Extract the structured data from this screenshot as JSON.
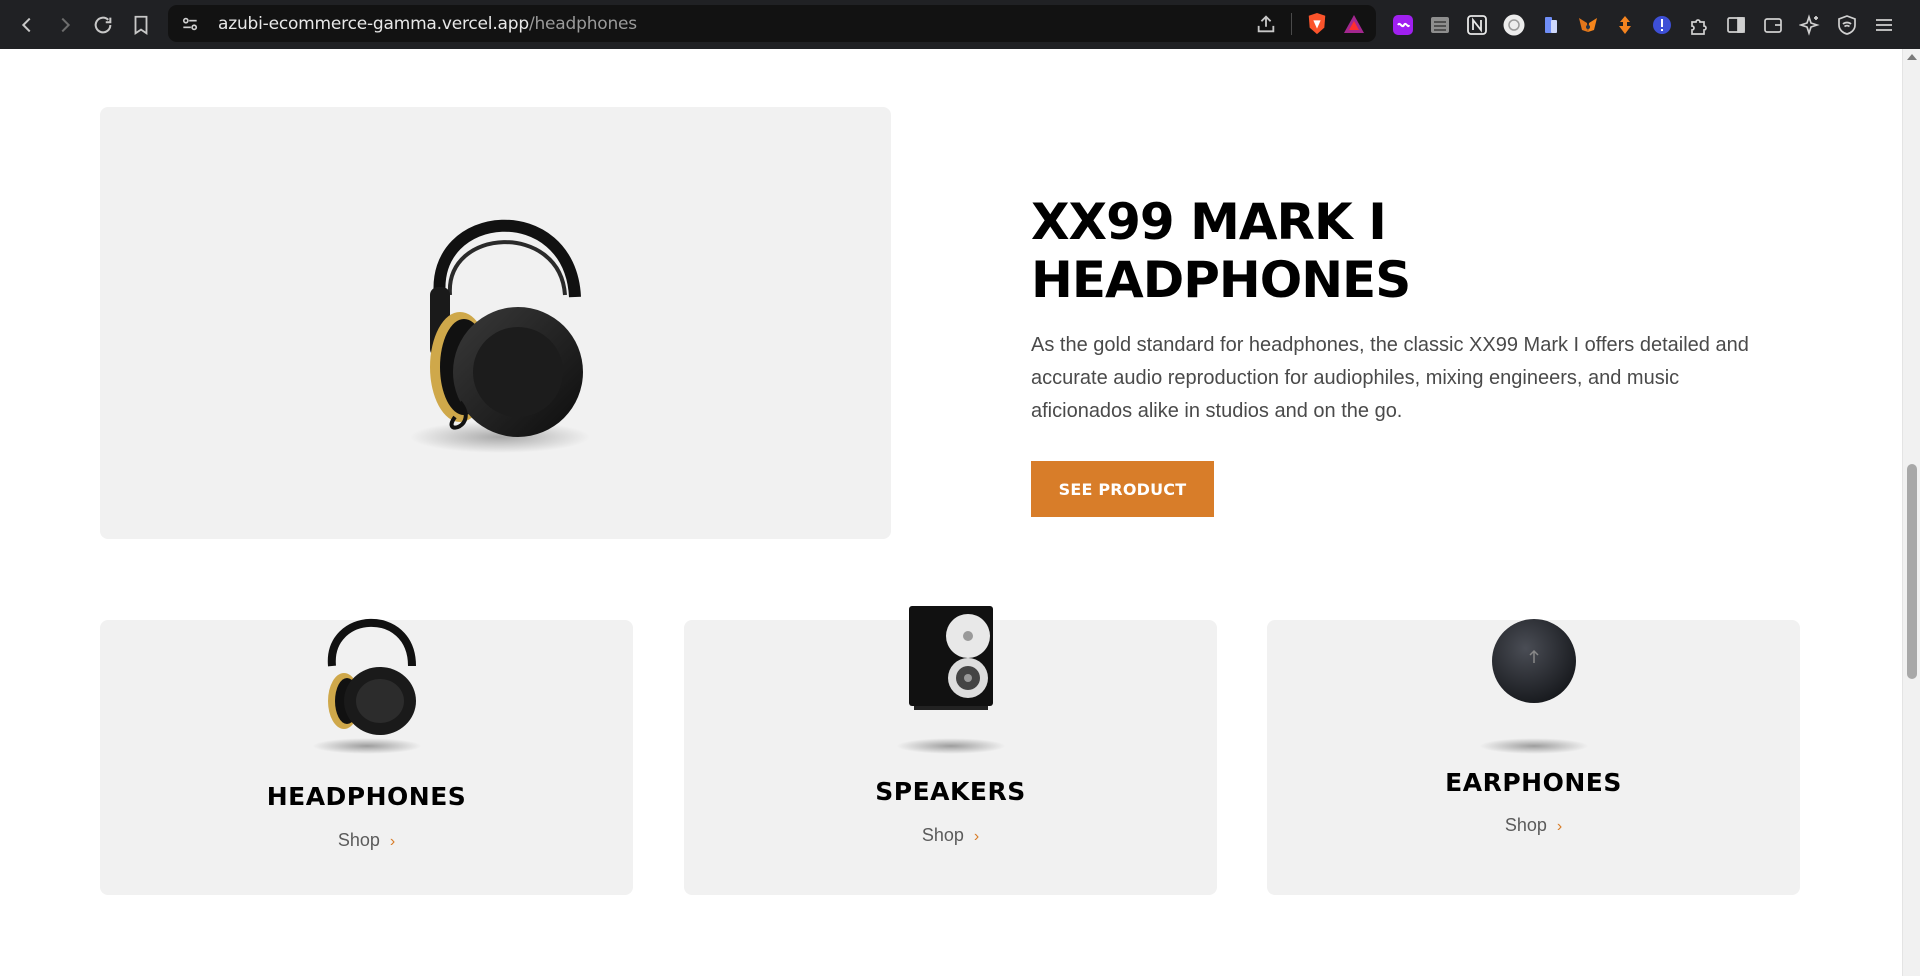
{
  "browser": {
    "url_host": "azubi-ecommerce-gamma.vercel.app",
    "url_path": "/headphones",
    "icons": [
      "back-icon",
      "forward-icon",
      "reload-icon",
      "bookmark-icon",
      "site-settings-icon",
      "share-icon",
      "brave-shield-icon",
      "brave-rewards-icon"
    ],
    "extensions": [
      "extension-purple-icon",
      "extension-stack-icon",
      "notion-icon",
      "openai-icon",
      "extension-blue-icon",
      "metamask-icon",
      "extension-orange-icon",
      "extension-alert-icon",
      "extensions-puzzle-icon",
      "sidebar-icon",
      "wallet-icon",
      "leo-ai-icon",
      "vpn-icon",
      "menu-icon"
    ]
  },
  "hero": {
    "title": "XX99 MARK I HEADPHONES",
    "description": "As the gold standard for headphones, the classic XX99 Mark I offers detailed and accurate audio reproduction for audiophiles, mixing engineers, and music aficionados alike in studios and on the go.",
    "button_label": "SEE PRODUCT",
    "accent_color": "#d87d29"
  },
  "categories": [
    {
      "title": "HEADPHONES",
      "shop_label": "Shop",
      "arrow": "›",
      "image": "headphones-image"
    },
    {
      "title": "SPEAKERS",
      "shop_label": "Shop",
      "arrow": "›",
      "image": "speaker-image"
    },
    {
      "title": "EARPHONES",
      "shop_label": "Shop",
      "arrow": "›",
      "image": "earphones-case-image"
    }
  ]
}
